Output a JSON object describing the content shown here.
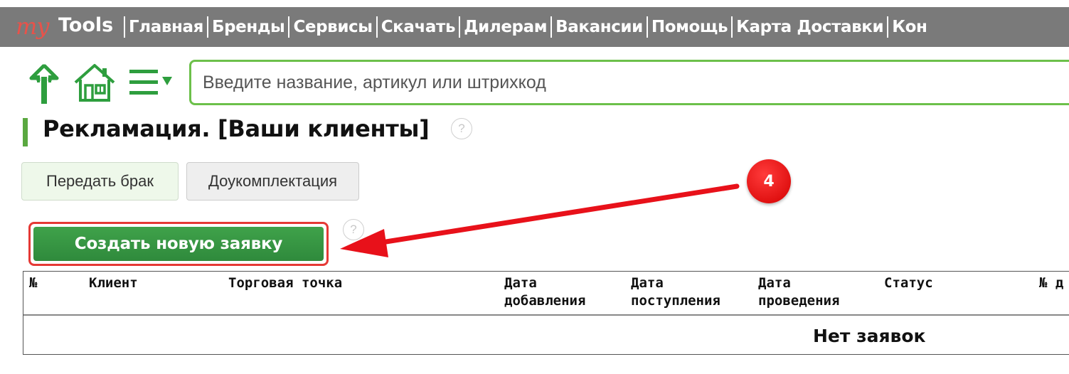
{
  "logo": {
    "my": "my",
    "tools": "Tools"
  },
  "nav": [
    "Главная",
    "Бренды",
    "Сервисы",
    "Скачать",
    "Дилерам",
    "Вакансии",
    "Помощь",
    "Карта Доставки",
    "Кон"
  ],
  "search": {
    "placeholder": "Введите название, артикул или штрихкод"
  },
  "page_title": "Рекламация. [Ваши клиенты]",
  "help_glyph": "?",
  "buttons": {
    "transfer_defect": "Передать брак",
    "completion": "Доукомплектация",
    "create": "Создать новую заявку"
  },
  "annotation": {
    "step": "4"
  },
  "table": {
    "headers": [
      "№",
      "Клиент",
      "Торговая точка",
      "Дата\nдобавления",
      "Дата\nпоступления",
      "Дата\nпроведения",
      "Статус",
      "№ д"
    ],
    "empty_text": "Нет заявок"
  },
  "colors": {
    "nav_bg": "#7a7a7a",
    "accent_green": "#5aa840",
    "search_border": "#6cc04a",
    "annotation_red": "#e53935"
  }
}
